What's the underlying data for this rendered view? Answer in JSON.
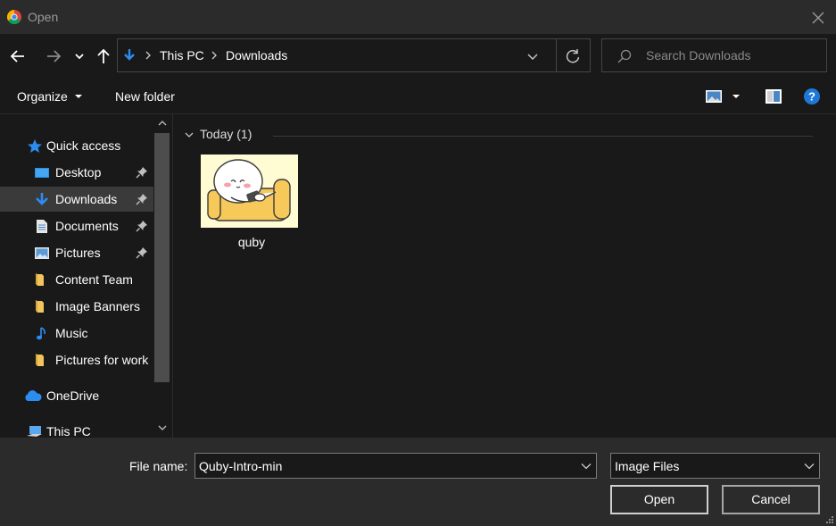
{
  "window": {
    "title": "Open"
  },
  "address": {
    "crumbs": [
      "This PC",
      "Downloads"
    ]
  },
  "search": {
    "placeholder": "Search Downloads"
  },
  "toolbar": {
    "organize_label": "Organize",
    "new_folder_label": "New folder"
  },
  "nav": {
    "items": [
      {
        "label": "Quick access",
        "icon": "star-icon"
      },
      {
        "label": "Desktop",
        "icon": "desktop-icon",
        "pinned": true
      },
      {
        "label": "Downloads",
        "icon": "download-arrow-icon",
        "pinned": true,
        "selected": true
      },
      {
        "label": "Documents",
        "icon": "document-icon",
        "pinned": true
      },
      {
        "label": "Pictures",
        "icon": "pictures-icon",
        "pinned": true
      },
      {
        "label": "Content Team",
        "icon": "folder-icon"
      },
      {
        "label": "Image Banners",
        "icon": "folder-icon"
      },
      {
        "label": "Music",
        "icon": "music-note-icon"
      },
      {
        "label": "Pictures for work",
        "icon": "folder-icon"
      },
      {
        "label": "OneDrive",
        "icon": "cloud-icon"
      },
      {
        "label": "This PC",
        "icon": "computer-icon"
      }
    ]
  },
  "content": {
    "group_label": "Today (1)",
    "files": [
      {
        "name": "quby"
      }
    ]
  },
  "bottom": {
    "file_name_label": "File name:",
    "file_name_value": "Quby-Intro-min",
    "filter_value": "Image Files",
    "open_label": "Open",
    "cancel_label": "Cancel"
  },
  "colors": {
    "background": "#191919",
    "chrome": "#2b2b2b",
    "selected_row": "#3a3a3a",
    "accent_blue": "#1e90ff",
    "folder_yellow": "#f2c55c"
  }
}
